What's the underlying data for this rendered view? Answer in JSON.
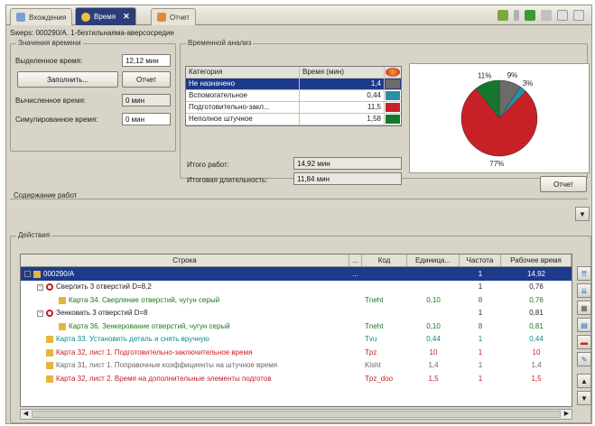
{
  "tabs": [
    {
      "label": "Вхождения",
      "active": false
    },
    {
      "label": "Время",
      "active": true
    },
    {
      "label": "Отчет",
      "active": false
    }
  ],
  "title_line": "Sweps: 000290/А. 1-безтильнаяма-аверсосредие",
  "time_values": {
    "group_title": "Значения времени",
    "allotted_label": "Выделенное время:",
    "allotted_value": "12,12 мин",
    "fill_button": "Заполнить...",
    "report_button": "Отчет",
    "calculated_label": "Вычисленное время:",
    "calculated_value": "0 мин",
    "simulated_label": "Симулированное время:",
    "simulated_value": "0 мин"
  },
  "analysis": {
    "group_title": "Временной анализ",
    "col_category": "Категория",
    "col_time": "Время (мин)",
    "rows": [
      {
        "category": "Не назначено",
        "time": "1,4",
        "color": "#6b6b6b"
      },
      {
        "category": "Вспомогательное",
        "time": "0,44",
        "color": "#2a8fa0"
      },
      {
        "category": "Подготовительно-закл...",
        "time": "11,5",
        "color": "#c82027"
      },
      {
        "category": "Неполное штучное",
        "time": "1,58",
        "color": "#13782e"
      }
    ],
    "total_work_label": "Итого работ:",
    "total_work_value": "14,92 мин",
    "total_duration_label": "Итоговая длительность:",
    "total_duration_value": "11,84 мин"
  },
  "chart_data": {
    "type": "pie",
    "title": "",
    "slices": [
      {
        "label": "Не назначено",
        "percent_label": "9%",
        "value": 1.4,
        "color": "#6b6b6b"
      },
      {
        "label": "Вспомогательное",
        "percent_label": "3%",
        "value": 0.44,
        "color": "#2a8fa0"
      },
      {
        "label": "Подготовительно-заключительное",
        "percent_label": "77%",
        "value": 11.5,
        "color": "#c82027"
      },
      {
        "label": "Неполное штучное",
        "percent_label": "11%",
        "value": 1.58,
        "color": "#13782e"
      }
    ]
  },
  "pie_report_button": "Отчет",
  "content_label": "Содержание работ",
  "actions": {
    "group_title": "Действия",
    "columns": [
      "Строка",
      "...",
      "Код",
      "Единица...",
      "Частота",
      "Рабочее время"
    ],
    "rows": [
      {
        "indent": 0,
        "text": "000290/А",
        "dots": "...",
        "code": "",
        "unit": "",
        "freq": "1",
        "work": "14,92",
        "style": "sel",
        "icon": "folder",
        "expander": "−"
      },
      {
        "indent": 1,
        "text": "Сверлить 3 отверстий D=8,2",
        "dots": "",
        "code": "",
        "unit": "",
        "freq": "1",
        "work": "0,76",
        "style": "",
        "icon": "circle",
        "expander": "−"
      },
      {
        "indent": 2,
        "text": "Карта 34. Сверление отверстий, чугун серый",
        "dots": "",
        "code": "Tneht",
        "unit": "0,10",
        "freq": "8",
        "work": "0,76",
        "style": "green",
        "icon": "folder",
        "expander": ""
      },
      {
        "indent": 1,
        "text": "Зенковать 3 отверстий D=8",
        "dots": "",
        "code": "",
        "unit": "",
        "freq": "1",
        "work": "0,81",
        "style": "",
        "icon": "circle",
        "expander": "−"
      },
      {
        "indent": 2,
        "text": "Карта 36. Зенкерование отверстий, чугун серый",
        "dots": "",
        "code": "Tneht",
        "unit": "0,10",
        "freq": "8",
        "work": "0,81",
        "style": "green",
        "icon": "folder",
        "expander": ""
      },
      {
        "indent": 1,
        "text": "Карта 33. Установить деталь и снять вручную",
        "dots": "",
        "code": "Tvu",
        "unit": "0,44",
        "freq": "1",
        "work": "0,44",
        "style": "teal",
        "icon": "folder",
        "expander": ""
      },
      {
        "indent": 1,
        "text": "Карта 32, лист 1. Подготовительно-заключительное время",
        "dots": "",
        "code": "Tpz",
        "unit": "10",
        "freq": "1",
        "work": "10",
        "style": "red",
        "icon": "folder",
        "expander": ""
      },
      {
        "indent": 1,
        "text": "Карта 31, лист 1. Поправочные коэффициенты на штучное время",
        "dots": "",
        "code": "Kisht",
        "unit": "1,4",
        "freq": "1",
        "work": "1,4",
        "style": "grey",
        "icon": "folder",
        "expander": ""
      },
      {
        "indent": 1,
        "text": "Карта 32, лист 2. Время на дополнительные элементы подготов",
        "dots": "",
        "code": "Tpz_doo",
        "unit": "1,5",
        "freq": "1",
        "work": "1,5",
        "style": "red",
        "icon": "folder",
        "expander": ""
      }
    ]
  }
}
